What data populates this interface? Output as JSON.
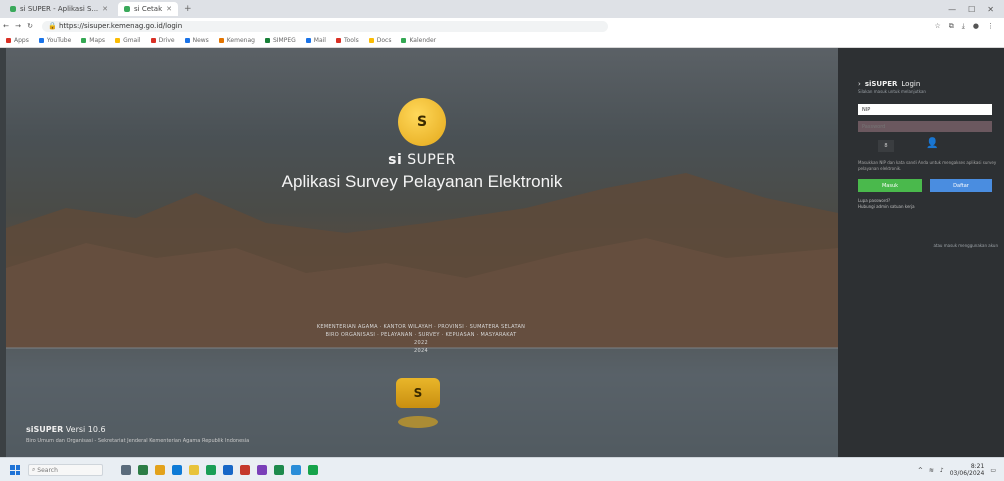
{
  "browser": {
    "tabs": [
      {
        "label": "si SUPER - Aplikasi S...",
        "active": false
      },
      {
        "label": "si Cetak",
        "active": true
      }
    ],
    "omnibox_url": "https://sisuper.kemenag.go.id/login",
    "bookmarks": [
      "Apps",
      "YouTube",
      "Maps",
      "Gmail",
      "Drive",
      "News",
      "Kemenag",
      "SIMPEG",
      "Mail",
      "Tools",
      "Docs",
      "Kalender"
    ],
    "bookmark_colors": [
      "#d93025",
      "#1a73e8",
      "#34a853",
      "#fbbc04",
      "#d93025",
      "#1a73e8",
      "#e37400",
      "#188038",
      "#1a73e8",
      "#d93025",
      "#fbbc04",
      "#34a853"
    ]
  },
  "hero": {
    "logo_char": "S",
    "brand_prefix": "si",
    "brand_name": "SUPER",
    "tagline": "Aplikasi Survey Pelayanan Elektronik",
    "fineprint_rows": [
      "KEMENTERIAN AGAMA · KANTOR WILAYAH · PROVINSI · SUMATERA SELATAN",
      "BIRO ORGANISASI · PELAYANAN · SURVEY · KEPUASAN · MASYARAKAT"
    ],
    "fineprint_year_1": "2022",
    "fineprint_year_2": "2024",
    "small_logo_char": "S"
  },
  "footer": {
    "app_name": "siSUPER",
    "version_text": "Versi 10.6",
    "copyright": "Biro Umum dan Organisasi - Sekretariat Jenderal Kementerian Agama Republik Indonesia"
  },
  "login": {
    "title_prefix": "siSUPER",
    "title_suffix": "Login",
    "subtitle": "Silakan masuk untuk melanjutkan",
    "username_value": "NIP",
    "password_placeholder": "Password",
    "captcha_text": "8",
    "note": "Masukkan NIP dan kata sandi Anda untuk mengakses aplikasi survey pelayanan elektronik.",
    "submit_label": "Masuk",
    "register_label": "Daftar",
    "extra_lines": [
      "Lupa password?",
      "Hubungi admin satuan kerja"
    ],
    "separator_text": "atau masuk menggunakan akun"
  },
  "taskbar": {
    "search_placeholder": "Search",
    "clock_time": "8:21",
    "clock_date": "03/06/2024"
  }
}
